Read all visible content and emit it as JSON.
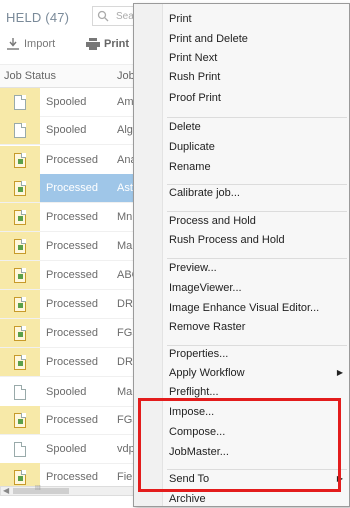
{
  "header": {
    "title": "HELD (47)",
    "search_placeholder": "Sea"
  },
  "toolbar": {
    "import_label": "Import",
    "print_label": "Print"
  },
  "columns": {
    "status": "Job Status",
    "job": "Job"
  },
  "rows": [
    {
      "status": "Spooled",
      "job": "Am",
      "kind": "spooled",
      "selected": false
    },
    {
      "status": "Spooled",
      "job": "Alg",
      "kind": "spooled",
      "selected": false
    },
    {
      "status": "Processed",
      "job": "Ana",
      "kind": "processed",
      "selected": false
    },
    {
      "status": "Processed",
      "job": "Ast",
      "kind": "processed",
      "selected": true
    },
    {
      "status": "Processed",
      "job": "Mnl",
      "kind": "processed",
      "selected": false
    },
    {
      "status": "Processed",
      "job": "Mar",
      "kind": "processed",
      "selected": false
    },
    {
      "status": "Processed",
      "job": "ABC",
      "kind": "processed",
      "selected": false
    },
    {
      "status": "Processed",
      "job": "DRP",
      "kind": "processed",
      "selected": false
    },
    {
      "status": "Processed",
      "job": "FGS",
      "kind": "processed",
      "selected": false
    },
    {
      "status": "Processed",
      "job": "DRP",
      "kind": "processed",
      "selected": false
    },
    {
      "status": "Spooled",
      "job": "Mar",
      "kind": "spooled",
      "selected": false
    },
    {
      "status": "Processed",
      "job": "FGS",
      "kind": "processed",
      "selected": false
    },
    {
      "status": "Spooled",
      "job": "vdp",
      "kind": "spooled",
      "selected": false
    },
    {
      "status": "Processed",
      "job": "Fier",
      "kind": "processed",
      "selected": false
    }
  ],
  "scrollbar": {
    "thumb_grip": "III"
  },
  "context_menu": {
    "items": [
      {
        "label": "Print"
      },
      {
        "label": "Print and Delete"
      },
      {
        "label": "Print Next"
      },
      {
        "label": "Rush Print"
      },
      {
        "label": "Proof Print"
      },
      {
        "label": "Delete"
      },
      {
        "label": "Duplicate"
      },
      {
        "label": "Rename"
      },
      {
        "label": "Calibrate job..."
      },
      {
        "label": "Process and Hold"
      },
      {
        "label": "Rush Process and Hold"
      },
      {
        "label": "Preview..."
      },
      {
        "label": "ImageViewer..."
      },
      {
        "label": "Image Enhance Visual Editor..."
      },
      {
        "label": "Remove Raster"
      },
      {
        "label": "Properties..."
      },
      {
        "label": "Apply Workflow",
        "submenu": true
      },
      {
        "label": "Preflight..."
      },
      {
        "label": "Impose..."
      },
      {
        "label": "Compose..."
      },
      {
        "label": "JobMaster..."
      },
      {
        "label": "Send To",
        "submenu": true
      },
      {
        "label": "Archive"
      }
    ]
  },
  "colors": {
    "selection": "#9fc6e8",
    "highlight_box": "#e31c1c",
    "icon_column": "#f7e9a8"
  }
}
